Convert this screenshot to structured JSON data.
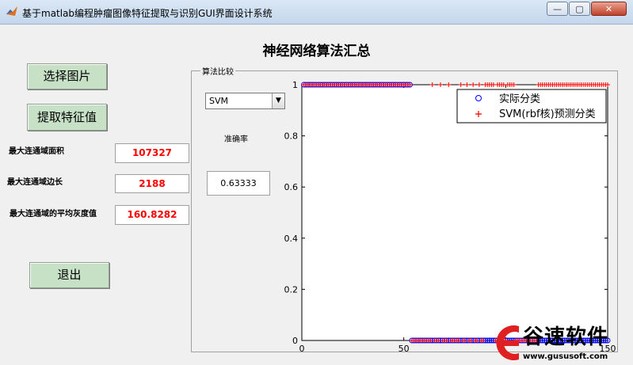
{
  "window": {
    "title": "基于matlab编程肿瘤图像特征提取与识别GUI界面设计系统",
    "minimize_label": "—",
    "maximize_label": "▢",
    "close_label": "✕"
  },
  "page_title": "神经网络算法汇总",
  "buttons": {
    "select_image": "选择图片",
    "extract_features": "提取特征值",
    "exit": "退出"
  },
  "features": [
    {
      "label": "最大连通域面积",
      "value": "107327"
    },
    {
      "label": "最大连通域边长",
      "value": "2188"
    },
    {
      "label": "最大连通域的平均灰度值",
      "value": "160.8282"
    }
  ],
  "comparison": {
    "group_title": "算法比较",
    "algorithm_select": {
      "selected": "SVM",
      "arrow": "▼"
    },
    "accuracy_label": "准确率",
    "accuracy_value": "0.63333"
  },
  "chart_data": {
    "type": "scatter",
    "xlim": [
      0,
      150
    ],
    "ylim": [
      0,
      1
    ],
    "xticks": [
      0,
      50,
      100,
      150
    ],
    "xtick_labels": [
      "0",
      "50",
      "",
      "150"
    ],
    "yticks": [
      0,
      0.2,
      0.4,
      0.6,
      0.8,
      1
    ],
    "ytick_labels": [
      "0",
      "0.2",
      "0.4",
      "0.6",
      "0.8",
      "1"
    ],
    "legend_position": "top-right",
    "series": [
      {
        "name": "实际分类",
        "marker": "circle",
        "color": "#0000ff",
        "segments": [
          {
            "from": 1,
            "to": 53,
            "y": 1
          },
          {
            "from": 54,
            "to": 150,
            "y": 0
          }
        ]
      },
      {
        "name": "SVM(rbf核)预测分类",
        "marker": "plus",
        "color": "#ff0000"
      }
    ]
  },
  "watermark": {
    "text": "谷速软件",
    "url": "www.gususoft.com"
  }
}
